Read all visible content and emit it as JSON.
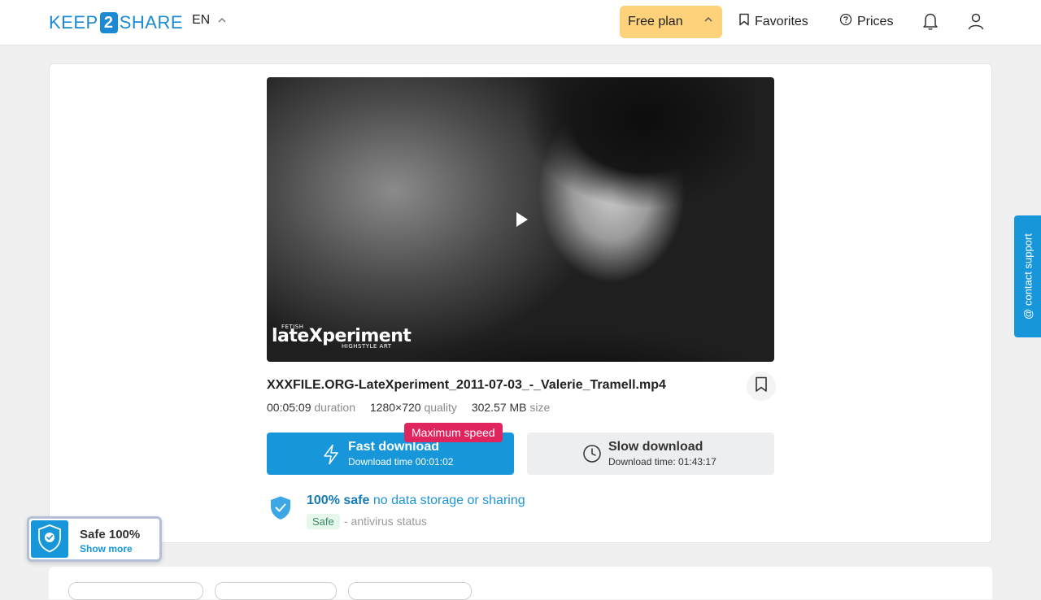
{
  "header": {
    "logo_left": "KEEP",
    "logo_mid": "2",
    "logo_right": "SHARE",
    "language": "EN",
    "plan_label": "Free plan",
    "favorites_label": "Favorites",
    "prices_label": "Prices"
  },
  "video": {
    "brand_small_top": "FETISH",
    "brand_big": "lateXperiment",
    "brand_small_bottom": "HIGHSTYLE ART"
  },
  "file": {
    "name": "XXXFILE.ORG-LateXperiment_2011-07-03_-_Valerie_Tramell.mp4",
    "duration_value": "00:05:09",
    "duration_label": "duration",
    "quality_value": "1280×720",
    "quality_label": "quality",
    "size_value": "302.57 MB",
    "size_label": "size"
  },
  "download": {
    "badge": "Maximum speed",
    "fast_title": "Fast download",
    "fast_sub": "Download time 00:01:02",
    "slow_title": "Slow download",
    "slow_sub": "Download time: 01:43:17"
  },
  "safety": {
    "strong": "100% safe",
    "rest": "no data storage or sharing",
    "tag": "Safe",
    "status": "- antivirus status"
  },
  "support": {
    "label": "@ contact support"
  },
  "safe_widget": {
    "title": "Safe 100%",
    "link": "Show more"
  },
  "colors": {
    "accent": "#1797d9",
    "plan_bg": "#fdd27a",
    "badge_bg": "#e0245e",
    "safe_tag_bg": "#e6f7ee"
  },
  "icons": {
    "favorites": "bookmark-icon",
    "prices": "question-circle-icon",
    "notifications": "bell-icon",
    "profile": "user-icon",
    "fast": "lightning-icon",
    "slow": "clock-icon",
    "safety": "shield-check-icon",
    "play": "play-icon"
  }
}
